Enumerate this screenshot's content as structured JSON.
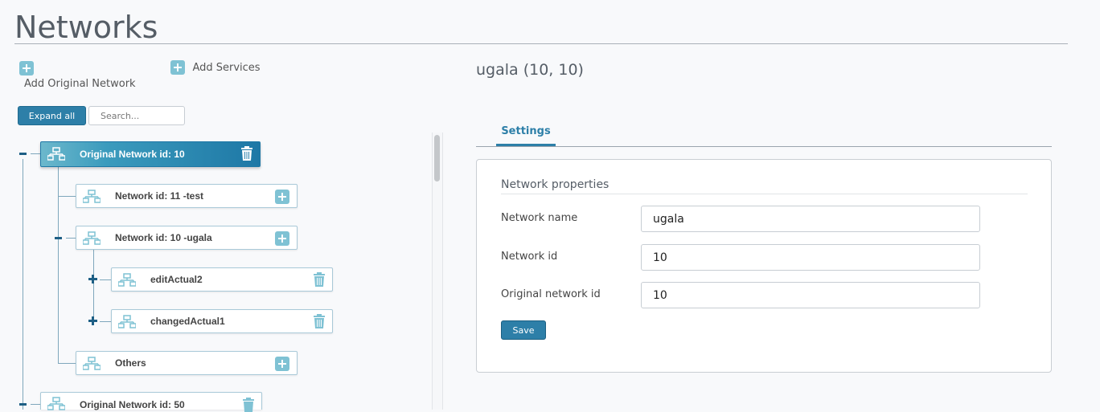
{
  "page": {
    "title": "Networks"
  },
  "toolbar": {
    "add_original_network_label": "Add Original Network",
    "add_services_label": "Add Services",
    "expand_all_label": "Expand all",
    "search_placeholder": "Search..."
  },
  "tree": {
    "nodes": [
      {
        "label": "Original Network id: 10",
        "selected": true,
        "action": "delete",
        "toggle": "collapse"
      },
      {
        "label": "Network id: 11 -test",
        "action": "add"
      },
      {
        "label": "Network id: 10 -ugala",
        "action": "add",
        "toggle": "collapse"
      },
      {
        "label": "editActual2",
        "action": "delete",
        "toggle": "expand"
      },
      {
        "label": "changedActual1",
        "action": "delete",
        "toggle": "expand"
      },
      {
        "label": "Others",
        "action": "add"
      },
      {
        "label": "Original Network id: 50",
        "action": "delete",
        "toggle": "collapse"
      }
    ]
  },
  "detail": {
    "title": "ugala (10, 10)",
    "tabs": [
      {
        "label": "Settings",
        "active": true
      }
    ],
    "section_title": "Network properties",
    "fields": [
      {
        "label": "Network name",
        "value": "ugala"
      },
      {
        "label": "Network id",
        "value": "10"
      },
      {
        "label": "Original network id",
        "value": "10"
      }
    ],
    "save_label": "Save"
  },
  "colors": {
    "accent": "#2d7fa8",
    "icon_light": "#7fc2d4",
    "tree_line": "#7fa7bc"
  }
}
